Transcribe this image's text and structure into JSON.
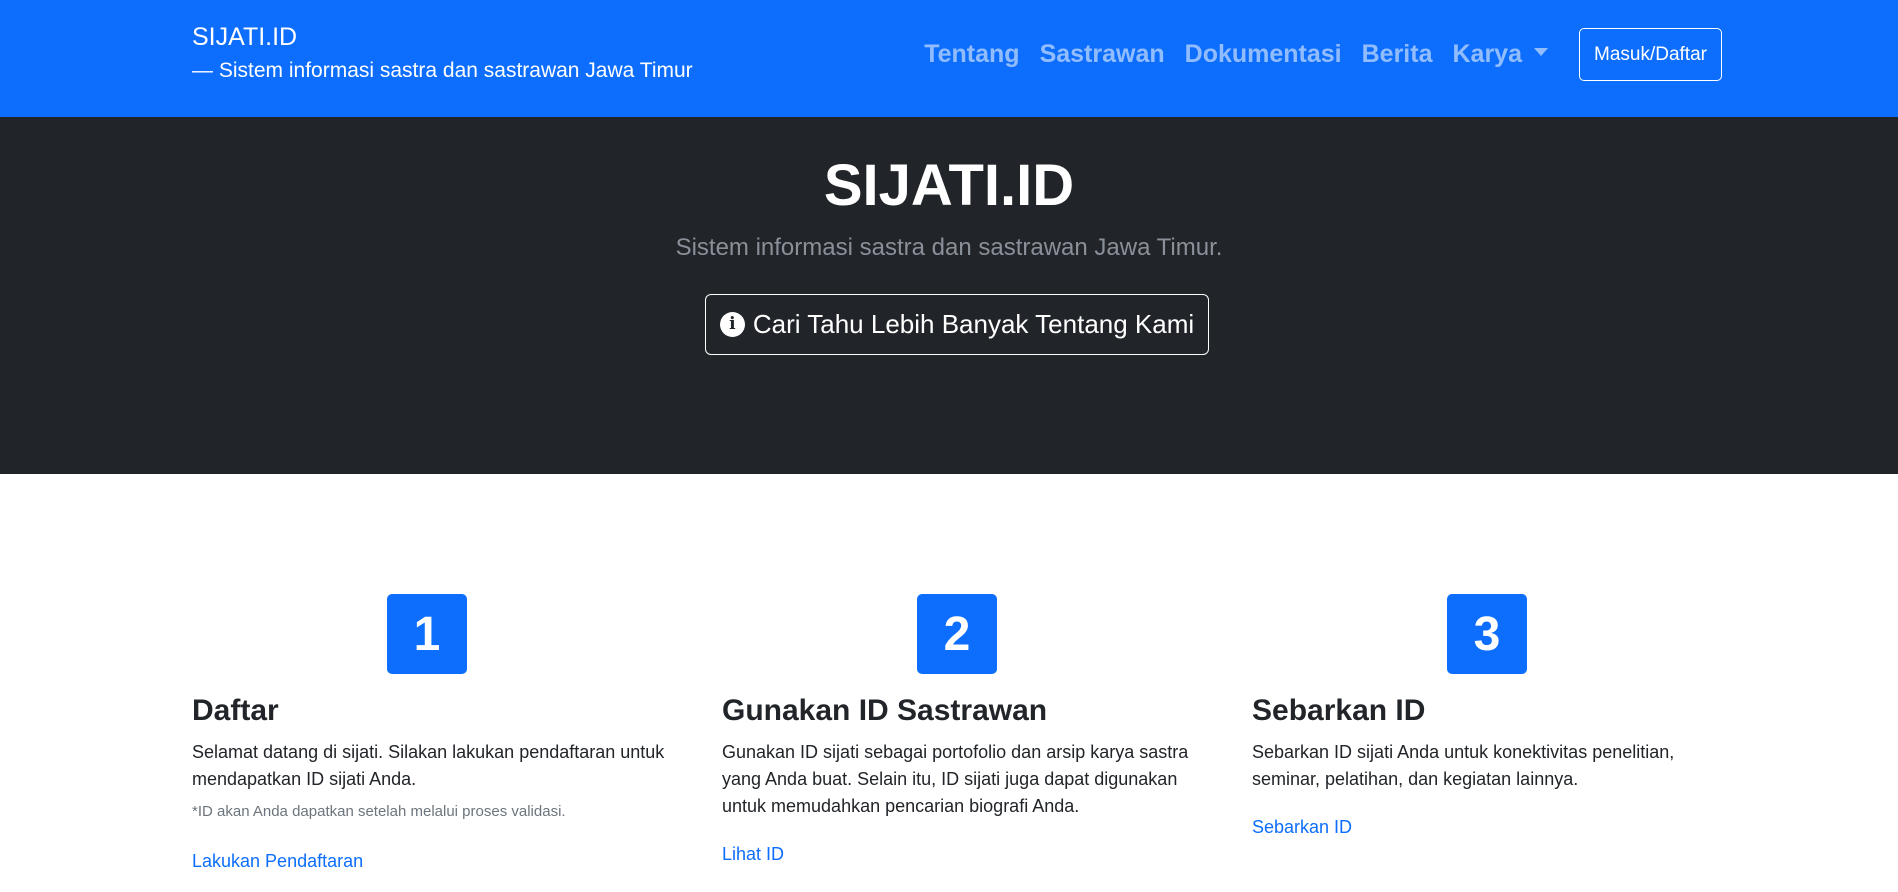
{
  "navbar": {
    "brand_title": "SIJATI.ID",
    "brand_subtitle": "— Sistem informasi sastra dan sastrawan Jawa Timur",
    "links": [
      "Tentang",
      "Sastrawan",
      "Dokumentasi",
      "Berita",
      "Karya"
    ],
    "login_label": "Masuk/Daftar"
  },
  "hero": {
    "title": "SIJATI.ID",
    "subtitle": "Sistem informasi sastra dan sastrawan Jawa Timur.",
    "button_label": "Cari Tahu Lebih Banyak Tentang Kami",
    "button_icon": "info-circle-icon"
  },
  "features": [
    {
      "number": "1",
      "title": "Daftar",
      "text": "Selamat datang di sijati. Silakan lakukan pendaftaran untuk mendapatkan ID sijati Anda.",
      "note": "*ID akan Anda dapatkan setelah melalui proses validasi.",
      "link": "Lakukan Pendaftaran"
    },
    {
      "number": "2",
      "title": "Gunakan ID Sastrawan",
      "text": "Gunakan ID sijati sebagai portofolio dan arsip karya sastra yang Anda buat. Selain itu, ID sijati juga dapat digunakan untuk memudahkan pencarian biografi Anda.",
      "link": "Lihat ID"
    },
    {
      "number": "3",
      "title": "Sebarkan ID",
      "text": "Sebarkan ID sijati Anda untuk konektivitas penelitian, seminar, pelatihan, dan kegiatan lainnya.",
      "link": "Sebarkan ID"
    }
  ],
  "colors": {
    "primary": "#0d6efd",
    "hero_bg": "#212529",
    "nav_link": "rgba(255,255,255,0.55)",
    "muted": "#6c757d"
  }
}
